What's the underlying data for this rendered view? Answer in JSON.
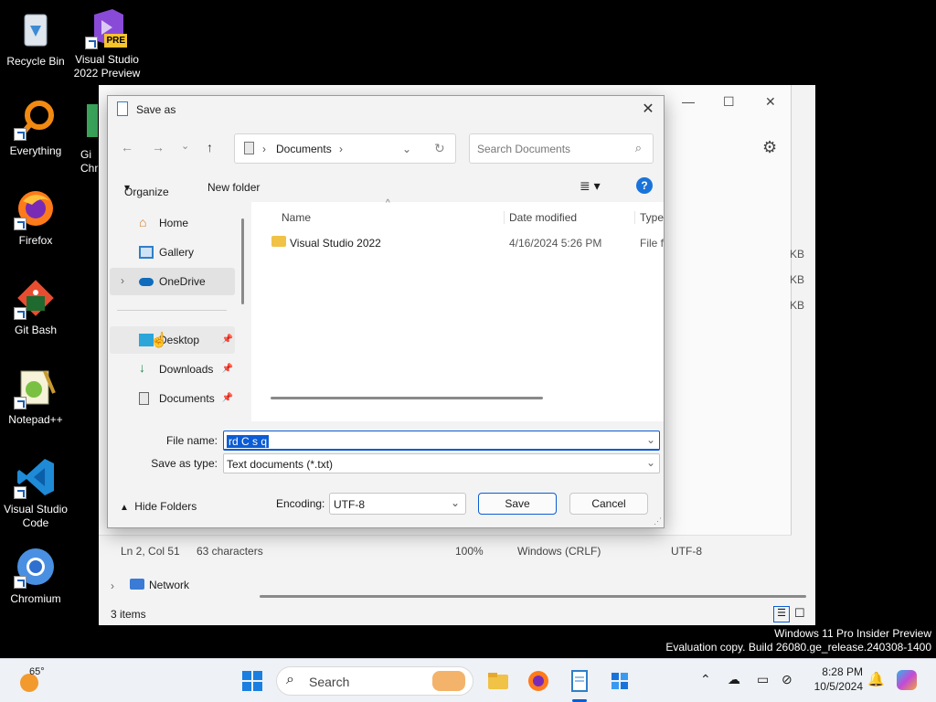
{
  "desktop": {
    "icons": [
      {
        "label": "Recycle Bin"
      },
      {
        "label": "Visual Studio 2022 Preview",
        "badge": "PRE"
      },
      {
        "label": "Everything"
      },
      {
        "label": "Firefox"
      },
      {
        "label": "Git Bash"
      },
      {
        "label": "Notepad++"
      },
      {
        "label": "Visual Studio Code"
      },
      {
        "label": "Chromium"
      },
      {
        "label": "Gi Chr"
      }
    ]
  },
  "back_window": {
    "status": {
      "position": "Ln 2, Col 51",
      "chars": "63 characters",
      "zoom": "100%",
      "line_ending": "Windows (CRLF)",
      "encoding": "UTF-8"
    },
    "sizes": [
      "KB",
      "KB",
      "KB"
    ],
    "nav_item": "Network",
    "items_count": "3 items"
  },
  "dialog": {
    "title": "Save as",
    "breadcrumb": "Documents",
    "search_placeholder": "Search Documents",
    "toolbar": {
      "organize": "Organize",
      "new_folder": "New folder"
    },
    "nav_items": [
      {
        "label": "Home",
        "icon": "home-icon"
      },
      {
        "label": "Gallery",
        "icon": "gallery-icon"
      },
      {
        "label": "OneDrive",
        "icon": "onedrive-icon"
      },
      {
        "label": "Desktop",
        "icon": "desktop-icon"
      },
      {
        "label": "Downloads",
        "icon": "downloads-icon"
      },
      {
        "label": "Documents",
        "icon": "documents-icon"
      }
    ],
    "columns": {
      "name": "Name",
      "date": "Date modified",
      "type": "Type"
    },
    "files": [
      {
        "name": "Visual Studio 2022",
        "date": "4/16/2024 5:26 PM",
        "type": "File fo"
      }
    ],
    "file_name_label": "File name:",
    "file_name_value": "rd C s q",
    "save_type_label": "Save as type:",
    "save_type_value": "Text documents (*.txt)",
    "hide_folders": "Hide Folders",
    "encoding_label": "Encoding:",
    "encoding_value": "UTF-8",
    "save_button": "Save",
    "cancel_button": "Cancel"
  },
  "watermark": {
    "line1": "Windows 11 Pro Insider Preview",
    "line2": "Evaluation copy. Build 26080.ge_release.240308-1400"
  },
  "taskbar": {
    "weather_temp": "65°",
    "search_label": "Search",
    "time": "8:28 PM",
    "date": "10/5/2024"
  },
  "colors": {
    "accent": "#0b5cd5",
    "taskbar_bg": "#eef1f5"
  }
}
